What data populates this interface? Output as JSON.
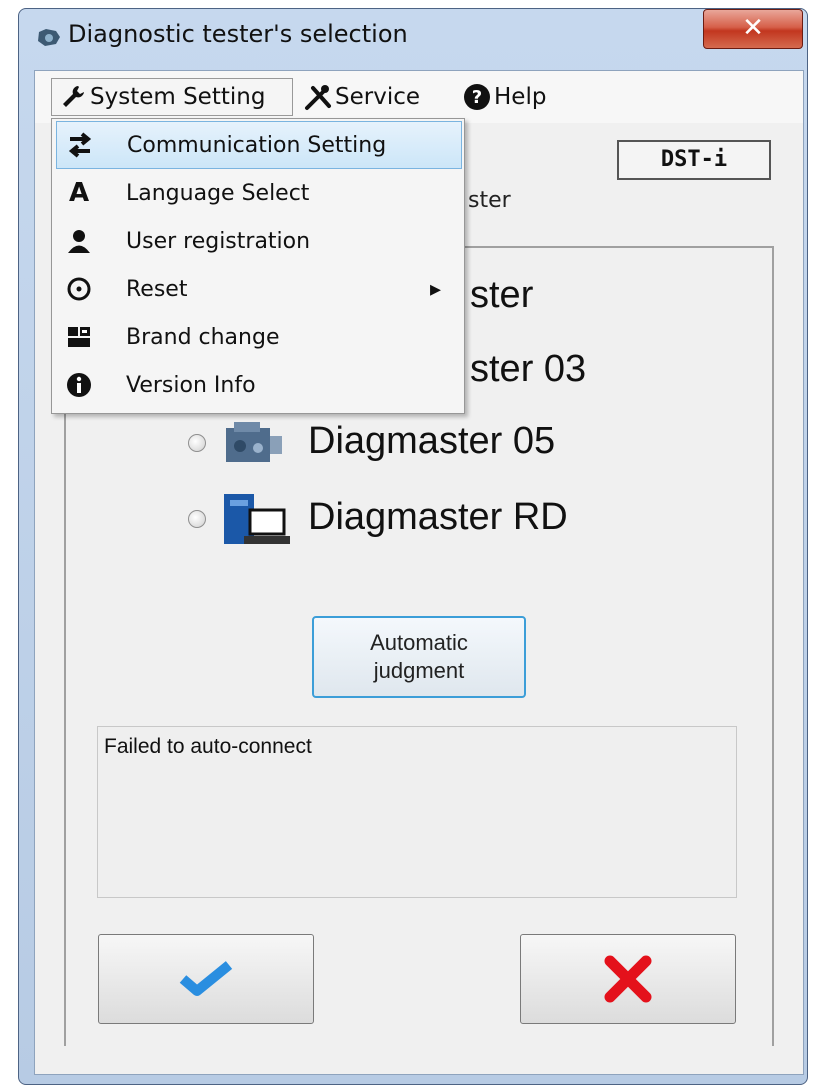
{
  "window": {
    "title": "Diagnostic tester's selection",
    "close_glyph": "✕"
  },
  "menubar": {
    "items": [
      {
        "label": "System Setting",
        "icon": "wrench-icon"
      },
      {
        "label": "Service",
        "icon": "tools-icon"
      },
      {
        "label": "Help",
        "icon": "question-icon"
      }
    ]
  },
  "dropdown": {
    "items": [
      {
        "label": "Communication Setting",
        "icon": "arrows-exchange-icon",
        "highlighted": true
      },
      {
        "label": "Language Select",
        "icon": "letter-a-icon"
      },
      {
        "label": "User registration",
        "icon": "user-icon"
      },
      {
        "label": "Reset",
        "icon": "reset-icon",
        "submenu_arrow": "▸"
      },
      {
        "label": "Brand change",
        "icon": "brand-icon"
      },
      {
        "label": "Version Info",
        "icon": "info-icon"
      }
    ]
  },
  "device_badge": "DST-i",
  "subtitle_partial": "ster",
  "testers": [
    {
      "label_partial": "ster"
    },
    {
      "label_partial": "ster 03"
    },
    {
      "label": "Diagmaster 05",
      "icon": "engine-icon"
    },
    {
      "label": "Diagmaster RD",
      "icon": "computer-icon"
    }
  ],
  "auto_button": {
    "line1": "Automatic",
    "line2": "judgment"
  },
  "status_text": "Failed to auto-connect",
  "colors": {
    "ok_check": "#2a8ee0",
    "cancel_x": "#e4111b",
    "title_bar": "#c6d8ee",
    "highlight": "#cce6f8"
  }
}
